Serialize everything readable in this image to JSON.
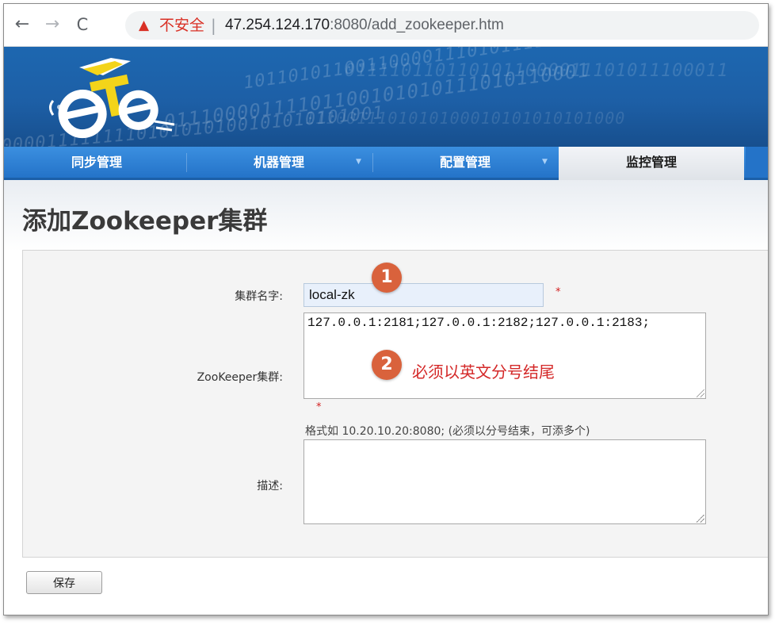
{
  "browser": {
    "back_icon": "←",
    "forward_icon": "→",
    "reload_icon": "C",
    "warning_icon": "▲",
    "insecure_label": "不安全",
    "separator": "|",
    "url_host": "47.254.124.170",
    "url_rest": ":8080/add_zookeeper.htm"
  },
  "banner": {
    "binary_rows": [
      "1011010110011000011101011110001111",
      "0111101101101011000011101011100011",
      "01110000111101100101010111010110001",
      "1110011101010100010101010101000",
      "0000111111110101010100101010101001"
    ],
    "logo_text": "eTe"
  },
  "nav": {
    "tabs": [
      {
        "label": "同步管理",
        "has_caret": false
      },
      {
        "label": "机器管理",
        "has_caret": true
      },
      {
        "label": "配置管理",
        "has_caret": true
      },
      {
        "label": "监控管理",
        "has_caret": false
      }
    ],
    "caret": "▼"
  },
  "page": {
    "title": "添加Zookeeper集群"
  },
  "form": {
    "cluster_name_label": "集群名字:",
    "cluster_name_value": "local-zk",
    "required_mark": "*",
    "zk_cluster_label": "ZooKeeper集群:",
    "zk_cluster_value": "127.0.0.1:2181;127.0.0.1:2182;127.0.0.1:2183;",
    "zk_hint": "格式如 10.20.10.20:8080; (必须以分号结束，可添多个)",
    "description_label": "描述:",
    "description_value": "",
    "save_label": "保存"
  },
  "annotations": {
    "badge_1": "1",
    "badge_2": "2",
    "note_2": "必须以英文分号结尾"
  },
  "colors": {
    "banner_blue": "#1d67b0",
    "tab_blue": "#2473c8",
    "badge_orange": "#d9623c",
    "annotation_red": "#d42828",
    "insecure_red": "#d93025"
  }
}
